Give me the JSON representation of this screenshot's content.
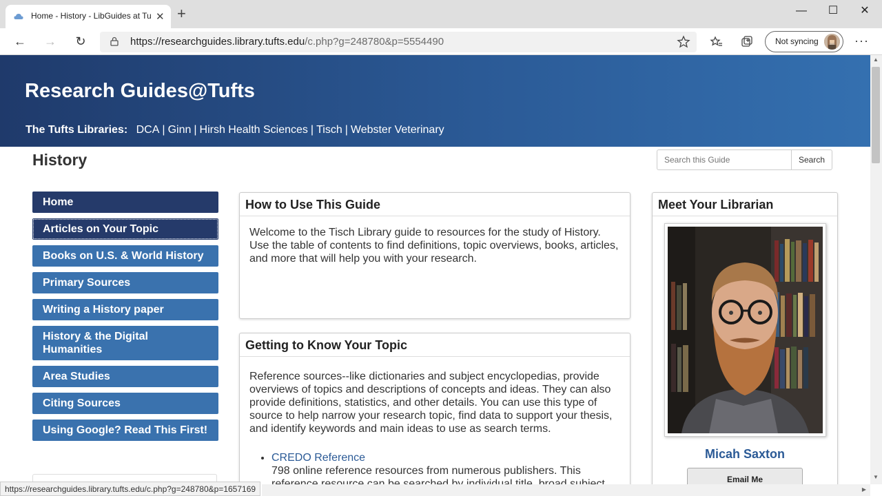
{
  "browser": {
    "tab_title": "Home - History - LibGuides at Tu",
    "url_host": "https://researchguides.library.tufts.edu",
    "url_path": "/c.php?g=248780&p=5554490",
    "sync_label": "Not syncing",
    "status_url": "https://researchguides.library.tufts.edu/c.php?g=248780&p=1657169"
  },
  "banner": {
    "title": "Research Guides@Tufts",
    "libs_label": "The Tufts Libraries:",
    "libs": [
      "DCA",
      "Ginn",
      "Hirsh Health Sciences",
      "Tisch",
      "Webster Veterinary"
    ]
  },
  "guide": {
    "title": "History",
    "search_placeholder": "Search this Guide",
    "search_button": "Search"
  },
  "nav": [
    "Home",
    "Articles on Your Topic",
    "Books on U.S. & World History",
    "Primary Sources",
    "Writing a History paper",
    "History & the Digital Humanities",
    "Area Studies",
    "Citing Sources",
    "Using Google? Read This First!"
  ],
  "how_to": {
    "heading": "How to Use This Guide",
    "body": "Welcome to the Tisch Library guide to resources for the study of History. Use the table of contents to find definitions, topic overviews, books, articles, and more that will help you with your research."
  },
  "topic": {
    "heading": "Getting to Know Your Topic",
    "body": "Reference sources--like dictionaries and subject encyclopedias, provide overviews of topics and descriptions of concepts and ideas. They can also provide definitions, statistics, and other details. You can use this type of source to help narrow your research topic, find data to support your thesis, and identify keywords and main ideas to use as search terms.",
    "resource_link": "CREDO Reference",
    "resource_desc": "798 online reference resources from numerous publishers. This reference resource can be searched by individual title, broad subject"
  },
  "librarian": {
    "heading": "Meet Your Librarian",
    "name": "Micah Saxton",
    "email_button": "Email Me"
  },
  "colors": {
    "banner": "#2b5a96",
    "nav_dark": "#253a6a",
    "nav_blue": "#3a72ae",
    "link": "#2b5a96"
  }
}
